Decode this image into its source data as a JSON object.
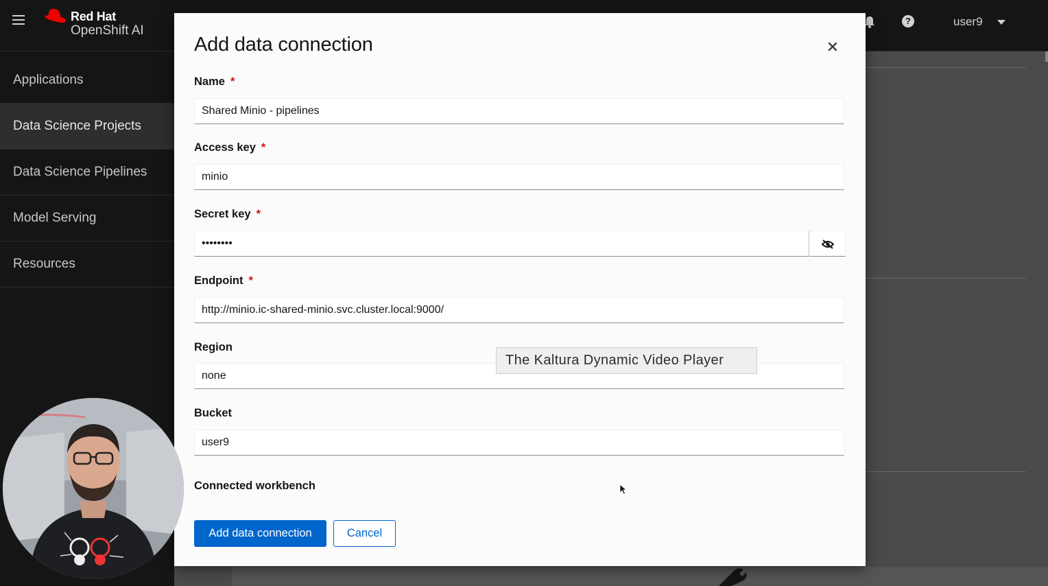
{
  "masthead": {
    "brand_line1": "Red Hat",
    "brand_line2": "OpenShift AI",
    "user_label": "user9",
    "icons": [
      "hamburger-icon",
      "redhat-logo-icon",
      "bell-icon",
      "help-icon",
      "caret-down-icon"
    ]
  },
  "sidebar": {
    "items": [
      {
        "label": "Applications",
        "active": false
      },
      {
        "label": "Data Science Projects",
        "active": true
      },
      {
        "label": "Data Science Pipelines",
        "active": false
      },
      {
        "label": "Model Serving",
        "active": false
      },
      {
        "label": "Resources",
        "active": false
      }
    ]
  },
  "modal": {
    "title": "Add data connection",
    "fields": {
      "name": {
        "label": "Name",
        "value": "Shared Minio - pipelines",
        "required": "*"
      },
      "access_key": {
        "label": "Access key",
        "value": "minio",
        "required": "*"
      },
      "secret_key": {
        "label": "Secret key",
        "value": "minio123",
        "required": "*"
      },
      "endpoint": {
        "label": "Endpoint",
        "value": "http://minio.ic-shared-minio.svc.cluster.local:9000/",
        "required": "*"
      },
      "region": {
        "label": "Region",
        "value": "none"
      },
      "bucket": {
        "label": "Bucket",
        "value": "user9"
      }
    },
    "connected_workbench_label": "Connected workbench",
    "submit_label": "Add data connection",
    "cancel_label": "Cancel"
  },
  "tooltip": {
    "text": "The Kaltura Dynamic Video Player"
  },
  "colors": {
    "primary": "#0066cc",
    "required": "#c9190b",
    "masthead_bg": "#151515",
    "sidebar_active": "#2e2e2e"
  }
}
